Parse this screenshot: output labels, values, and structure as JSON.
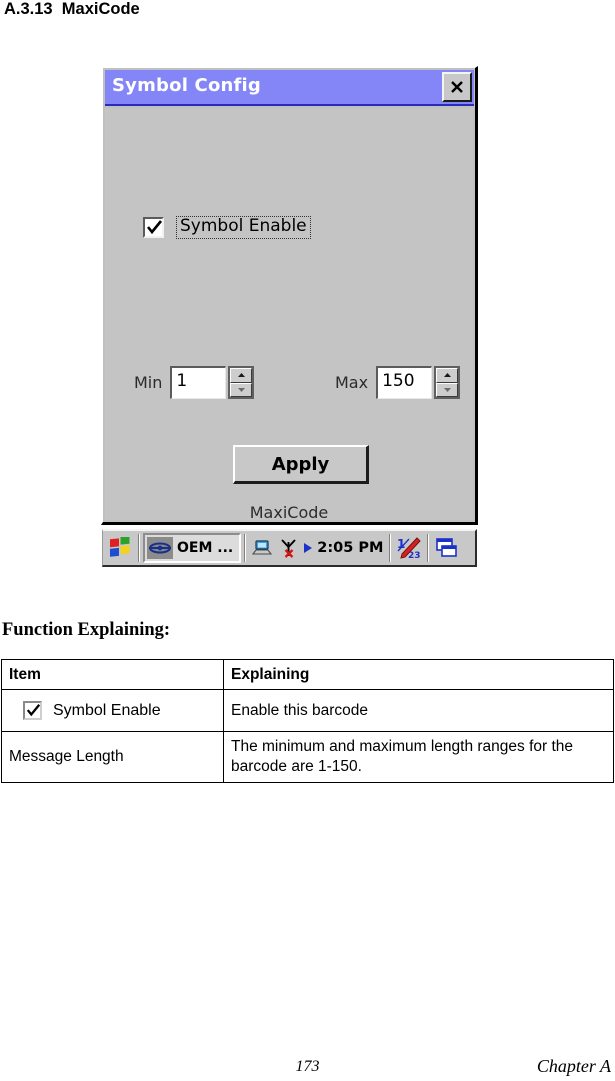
{
  "page": {
    "heading": "A.3.13  MaxiCode",
    "function_heading": "Function Explaining:",
    "footer_page_number": "173",
    "footer_chapter": "Chapter A"
  },
  "dialog": {
    "title": "Symbol Config",
    "close_icon": "close-icon",
    "titlebar_color": "#8486f7",
    "body_color": "#c4c4c4",
    "checkbox": {
      "label": "Symbol Enable",
      "checked": true
    },
    "min": {
      "label": "Min",
      "value": "1",
      "up_icon": "spinner-up-icon",
      "down_icon": "spinner-down-icon"
    },
    "max": {
      "label": "Max",
      "value": "150",
      "up_icon": "spinner-up-icon",
      "down_icon": "spinner-down-icon"
    },
    "apply_label": "Apply",
    "symbology_name": "MaxiCode"
  },
  "taskbar": {
    "start_icon": "windows-start-icon",
    "task": {
      "icon": "oem-app-icon",
      "label": "OEM ..."
    },
    "tray": [
      {
        "icon": "desktop-network-icon"
      },
      {
        "icon": "wireless-disconnected-icon"
      },
      {
        "icon": "play-arrow-icon"
      }
    ],
    "clock": "2:05 PM",
    "right_icons": [
      {
        "icon": "input-panel-pen-icon"
      },
      {
        "icon": "window-switch-icon"
      }
    ]
  },
  "table": {
    "headers": [
      "Item",
      "Explaining"
    ],
    "rows": [
      {
        "item_type": "checkbox",
        "item_label": "Symbol Enable",
        "item_checked": true,
        "explaining": "Enable this barcode"
      },
      {
        "item_type": "text",
        "item_label": "Message Length",
        "explaining": "The minimum and maximum length ranges for the barcode are 1-150."
      }
    ]
  }
}
